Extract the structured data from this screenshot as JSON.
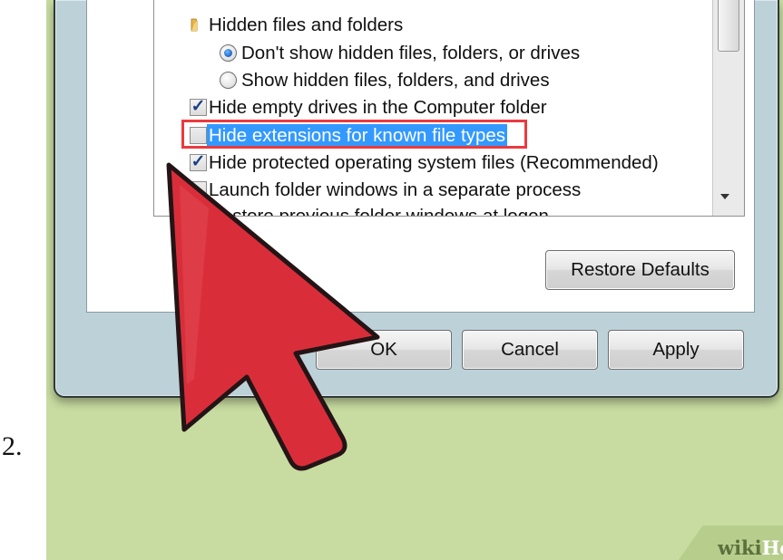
{
  "step_number": "2.",
  "advanced_settings": {
    "group_heading": "Hidden files and folders",
    "group_icon": "folder-icon",
    "radio_options": [
      {
        "label": "Don't show hidden files, folders, or drives",
        "checked": true
      },
      {
        "label": "Show hidden files, folders, and drives",
        "checked": false
      }
    ],
    "checkbox_options": [
      {
        "label": "Hide empty drives in the Computer folder",
        "checked": true
      },
      {
        "label": "Hide extensions for known file types",
        "checked": false,
        "highlighted": true
      },
      {
        "label": "Hide protected operating system files (Recommended)",
        "checked": true
      },
      {
        "label": "Launch folder windows in a separate process",
        "checked": false
      },
      {
        "label": "Restore previous folder windows at logon",
        "checked": false
      }
    ]
  },
  "buttons": {
    "restore_defaults": "Restore Defaults",
    "ok": "OK",
    "cancel": "Cancel",
    "apply": "Apply"
  },
  "watermark": {
    "wiki": "wiki",
    "how": "How"
  },
  "colors": {
    "highlight": "#3399ff",
    "annotation_red": "#d92e3a",
    "annotation_box": "#ea3a3f",
    "background_green": "#c8dca1",
    "checkmark": "#1a3f86"
  }
}
